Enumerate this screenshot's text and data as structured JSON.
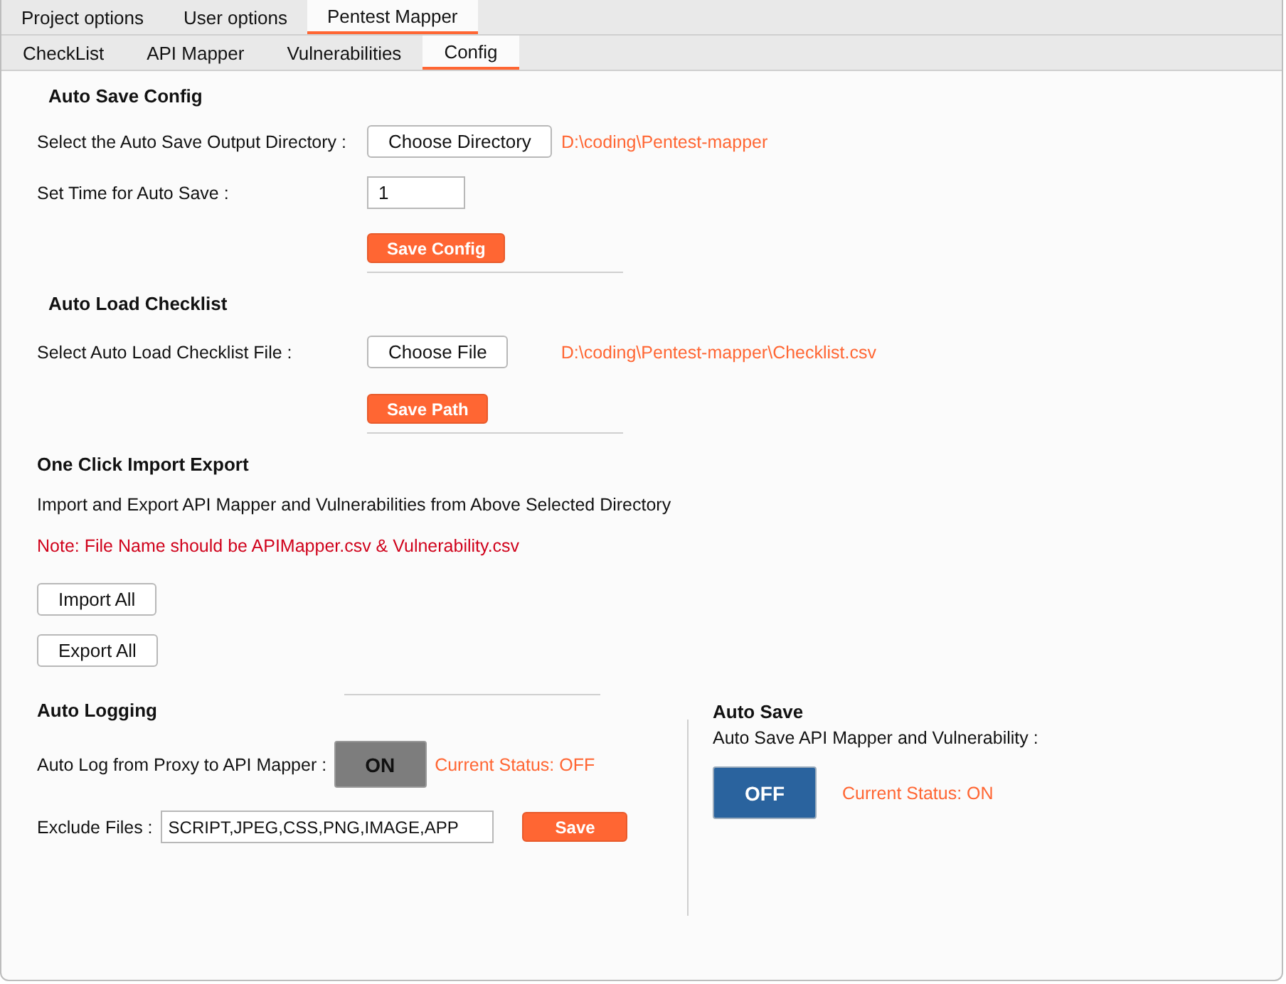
{
  "top_tabs": [
    {
      "label": "Project options",
      "selected": false
    },
    {
      "label": "User options",
      "selected": false
    },
    {
      "label": "Pentest Mapper",
      "selected": true
    }
  ],
  "sub_tabs": [
    {
      "label": "CheckList",
      "selected": false
    },
    {
      "label": "API Mapper",
      "selected": false
    },
    {
      "label": "Vulnerabilities",
      "selected": false
    },
    {
      "label": "Config",
      "selected": true
    }
  ],
  "auto_save_config": {
    "heading": "Auto Save Config",
    "directory_label": "Select the Auto Save Output Directory :",
    "choose_button": "Choose Directory",
    "directory_path": "D:\\coding\\Pentest-mapper",
    "time_label": "Set Time for Auto Save :",
    "time_value": "1",
    "save_button": "Save Config"
  },
  "auto_load_checklist": {
    "heading": "Auto Load Checklist",
    "file_label": "Select Auto Load Checklist File :",
    "choose_button": "Choose File",
    "file_path": "D:\\coding\\Pentest-mapper\\Checklist.csv",
    "save_button": "Save Path"
  },
  "import_export": {
    "heading": "One Click Import Export",
    "description": "Import and Export API Mapper and Vulnerabilities from Above Selected Directory",
    "note": "Note: File Name should be APIMapper.csv & Vulnerability.csv",
    "buttons": [
      "Import All",
      "Export All"
    ]
  },
  "auto_logging": {
    "heading": "Auto Logging",
    "toggle_label": "Auto Log from Proxy to API Mapper :",
    "toggle": {
      "label": "ON",
      "on": false
    },
    "status": "Current Status: OFF",
    "exclude_label": "Exclude Files :",
    "exclude_value": "SCRIPT,JPEG,CSS,PNG,IMAGE,APP",
    "save_button": "Save"
  },
  "auto_save": {
    "heading": "Auto Save",
    "label": "Auto Save API Mapper and Vulnerability :",
    "toggle": {
      "label": "OFF",
      "on": true
    },
    "status": "Current Status: ON"
  }
}
